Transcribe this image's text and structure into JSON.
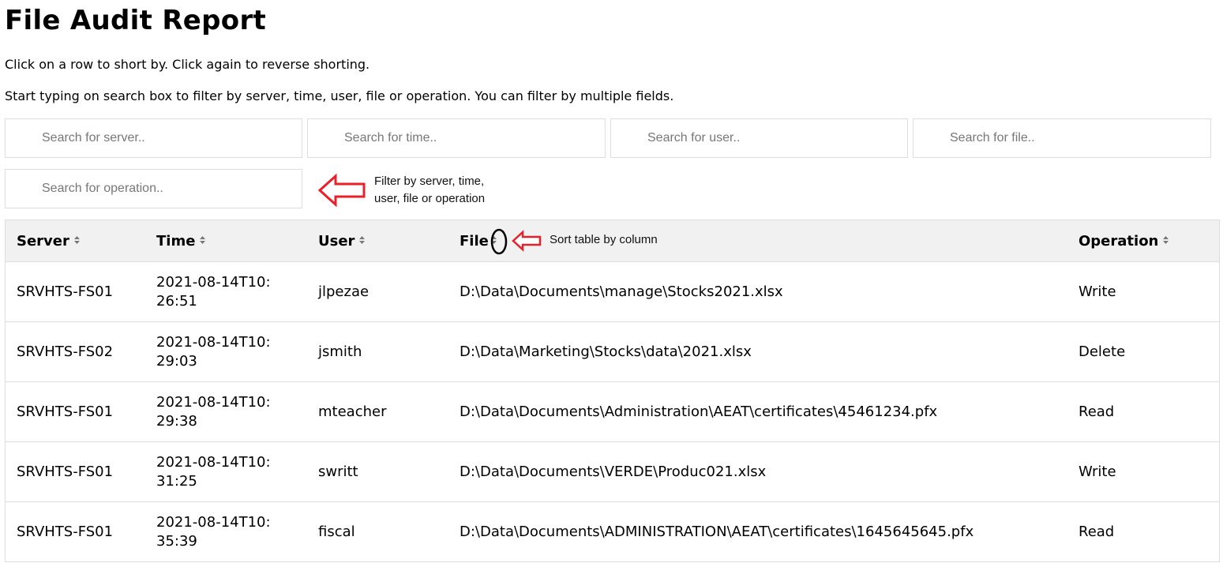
{
  "page": {
    "title": "File Audit Report",
    "instructions": [
      "Click on a row to short by. Click again to reverse shorting.",
      "Start typing on search box to filter by server, time, user, file or operation. You can filter by multiple fields."
    ]
  },
  "search": {
    "server_placeholder": "Search for server..",
    "time_placeholder": "Search for time..",
    "user_placeholder": "Search for user..",
    "file_placeholder": "Search for file..",
    "operation_placeholder": "Search for operation.."
  },
  "annotations": {
    "filter_line1": "Filter by server, time,",
    "filter_line2": "user, file or operation",
    "sort": "Sort table by column",
    "arrow_color": "#e8202a"
  },
  "table": {
    "headers": [
      "Server",
      "Time",
      "User",
      "File",
      "Operation"
    ],
    "rows": [
      [
        "SRVHTS-FS01",
        "2021-08-14T10:26:51",
        "jlpezae",
        "D:\\Data\\Documents\\manage\\Stocks2021.xlsx",
        "Write"
      ],
      [
        "SRVHTS-FS02",
        "2021-08-14T10:29:03",
        "jsmith",
        "D:\\Data\\Marketing\\Stocks\\data\\2021.xlsx",
        "Delete"
      ],
      [
        "SRVHTS-FS01",
        "2021-08-14T10:29:38",
        "mteacher",
        "D:\\Data\\Documents\\Administration\\AEAT\\certificates\\45461234.pfx",
        "Read"
      ],
      [
        "SRVHTS-FS01",
        "2021-08-14T10:31:25",
        "swritt",
        "D:\\Data\\Documents\\VERDE\\Produc021.xlsx",
        "Write"
      ],
      [
        "SRVHTS-FS01",
        "2021-08-14T10:35:39",
        "fiscal",
        "D:\\Data\\Documents\\ADMINISTRATION\\AEAT\\certificates\\1645645645.pfx",
        "Read"
      ]
    ]
  },
  "colors": {
    "header_background": "#f1f1f1",
    "border": "#dddddd",
    "annotation_red": "#e8202a"
  }
}
